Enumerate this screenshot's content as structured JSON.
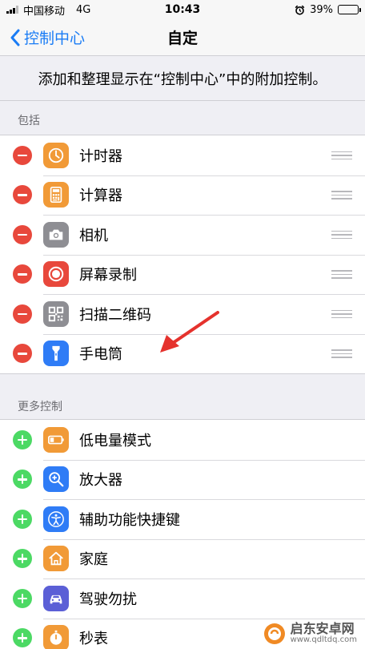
{
  "status_bar": {
    "carrier": "中国移动",
    "network": "4G",
    "time": "10:43",
    "battery": "39%",
    "battery_level": 0.39
  },
  "nav": {
    "back_label": "控制中心",
    "title": "自定"
  },
  "description": "添加和整理显示在“控制中心”中的附加控制。",
  "included": {
    "header": "包括",
    "items": [
      {
        "label": "计时器",
        "icon": "timer-icon",
        "color": "#f19a37"
      },
      {
        "label": "计算器",
        "icon": "calculator-icon",
        "color": "#f19a37"
      },
      {
        "label": "相机",
        "icon": "camera-icon",
        "color": "#8e8e93"
      },
      {
        "label": "屏幕录制",
        "icon": "screen-record-icon",
        "color": "#e8483c"
      },
      {
        "label": "扫描二维码",
        "icon": "qr-code-icon",
        "color": "#8e8e93"
      },
      {
        "label": "手电筒",
        "icon": "flashlight-icon",
        "color": "#2f7cf6"
      }
    ]
  },
  "more": {
    "header": "更多控制",
    "items": [
      {
        "label": "低电量模式",
        "icon": "low-power-icon",
        "color": "#f19a37"
      },
      {
        "label": "放大器",
        "icon": "magnifier-icon",
        "color": "#2f7cf6"
      },
      {
        "label": "辅助功能快捷键",
        "icon": "accessibility-icon",
        "color": "#2f7cf6"
      },
      {
        "label": "家庭",
        "icon": "home-icon",
        "color": "#f19a37"
      },
      {
        "label": "驾驶勿扰",
        "icon": "car-icon",
        "color": "#5b5fd6"
      },
      {
        "label": "秒表",
        "icon": "stopwatch-icon",
        "color": "#f19a37"
      }
    ]
  },
  "watermark": {
    "name": "启东安卓网",
    "url": "www.qdltdq.com"
  },
  "colors": {
    "accent": "#1a7cf5",
    "remove": "#e8483c",
    "add": "#4cd964",
    "annotation_arrow": "#e5322d"
  }
}
